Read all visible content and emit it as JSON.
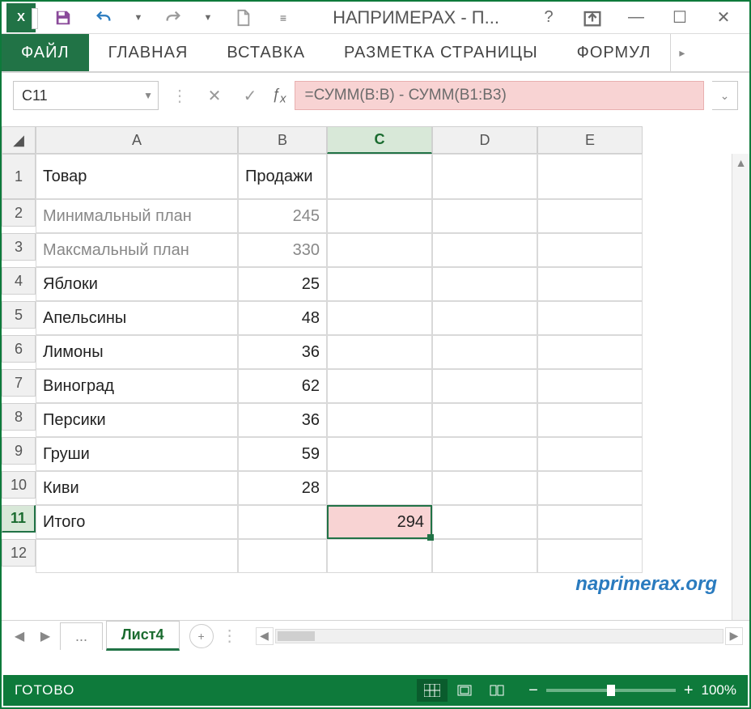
{
  "title": "НАПРИМЕРАХ - П...",
  "ribbon": {
    "tabs": [
      "ФАЙЛ",
      "ГЛАВНАЯ",
      "ВСТАВКА",
      "РАЗМЕТКА СТРАНИЦЫ",
      "ФОРМУЛ"
    ],
    "active_index": 0
  },
  "namebox": "C11",
  "formula": "=СУММ(B:B) - СУММ(B1:B3)",
  "columns": [
    "A",
    "B",
    "C",
    "D",
    "E"
  ],
  "selected_col": "C",
  "selected_row": "11",
  "headers": {
    "a": "Товар",
    "b": "Продажи"
  },
  "rows": [
    {
      "n": "1"
    },
    {
      "n": "2",
      "a": "Минимальный план",
      "b": "245",
      "gray": true
    },
    {
      "n": "3",
      "a": "Максмальный план",
      "b": "330",
      "gray": true
    },
    {
      "n": "4",
      "a": "Яблоки",
      "b": "25"
    },
    {
      "n": "5",
      "a": "Апельсины",
      "b": "48"
    },
    {
      "n": "6",
      "a": "Лимоны",
      "b": "36"
    },
    {
      "n": "7",
      "a": "Виноград",
      "b": "62"
    },
    {
      "n": "8",
      "a": "Персики",
      "b": "36"
    },
    {
      "n": "9",
      "a": "Груши",
      "b": "59"
    },
    {
      "n": "10",
      "a": "Киви",
      "b": "28"
    },
    {
      "n": "11",
      "a": "Итого",
      "b": "",
      "c": "294",
      "selected": true
    },
    {
      "n": "12"
    }
  ],
  "sheet": {
    "ellipsis": "...",
    "active": "Лист4"
  },
  "status": {
    "text": "ГОТОВО",
    "zoom": "100%"
  },
  "watermark": "naprimerax.org"
}
